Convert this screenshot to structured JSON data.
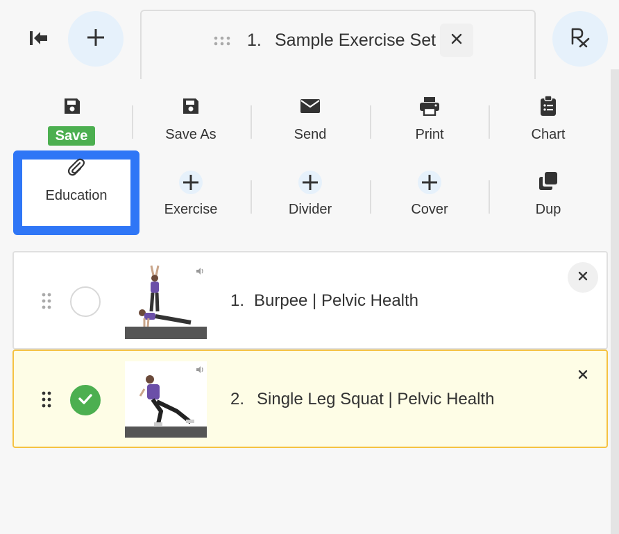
{
  "header": {
    "collapse_icon": "collapse-left-icon",
    "add_icon": "plus-icon",
    "tab": {
      "number": "1.",
      "title": "Sample Exercise Set"
    },
    "rx_icon": "prescription-icon"
  },
  "toolbar": {
    "row1": [
      {
        "label": "Save",
        "icon": "save-icon"
      },
      {
        "label": "Save As",
        "icon": "save-icon"
      },
      {
        "label": "Send",
        "icon": "envelope-icon"
      },
      {
        "label": "Print",
        "icon": "printer-icon"
      },
      {
        "label": "Chart",
        "icon": "clipboard-icon"
      }
    ],
    "row2": [
      {
        "label": "Education",
        "icon": "paperclip-icon"
      },
      {
        "label": "Exercise",
        "icon": "plus-icon"
      },
      {
        "label": "Divider",
        "icon": "plus-icon"
      },
      {
        "label": "Cover",
        "icon": "plus-icon"
      },
      {
        "label": "Dup",
        "icon": "duplicate-icon"
      }
    ]
  },
  "exercises": [
    {
      "number": "1.",
      "title": "Burpee | Pelvic Health",
      "checked": false
    },
    {
      "number": "2.",
      "title": "Single Leg Squat | Pelvic Health",
      "checked": true
    }
  ],
  "colors": {
    "accent_blue": "#2f76f6",
    "save_green": "#4caf50",
    "checked_row_bg": "#fefde6",
    "checked_row_border": "#f5c242",
    "circle_button_bg": "#e6f1fb"
  }
}
